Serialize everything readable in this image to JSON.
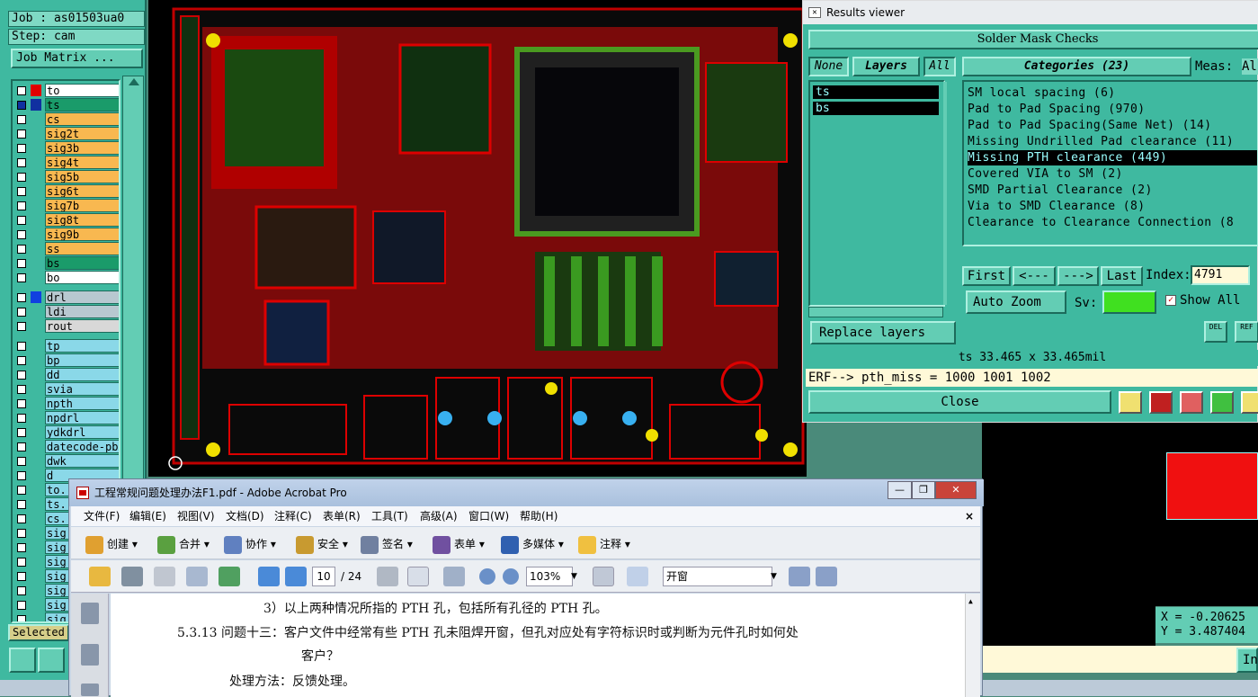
{
  "left_panel": {
    "job_label": "Job : as01503ua0",
    "step_label": "Step: cam",
    "job_matrix_button": "Job Matrix ...",
    "layers": [
      {
        "name": "to",
        "color": "#e00000",
        "bg": "#ffffff",
        "checked": false
      },
      {
        "name": "ts",
        "color": "#1030a0",
        "bg": "#1a9b6a",
        "checked": true
      },
      {
        "name": "cs",
        "color": "",
        "bg": "#f8b850",
        "checked": false
      },
      {
        "name": "sig2t",
        "color": "",
        "bg": "#f8b850",
        "checked": false
      },
      {
        "name": "sig3b",
        "color": "",
        "bg": "#f8b850",
        "checked": false
      },
      {
        "name": "sig4t",
        "color": "",
        "bg": "#f8b850",
        "checked": false
      },
      {
        "name": "sig5b",
        "color": "",
        "bg": "#f8b850",
        "checked": false
      },
      {
        "name": "sig6t",
        "color": "",
        "bg": "#f8b850",
        "checked": false
      },
      {
        "name": "sig7b",
        "color": "",
        "bg": "#f8b850",
        "checked": false
      },
      {
        "name": "sig8t",
        "color": "",
        "bg": "#f8b850",
        "checked": false
      },
      {
        "name": "sig9b",
        "color": "",
        "bg": "#f8b850",
        "checked": false
      },
      {
        "name": "ss",
        "color": "",
        "bg": "#f8b850",
        "checked": false
      },
      {
        "name": "bs",
        "color": "",
        "bg": "#1a9b6a",
        "checked": false
      },
      {
        "name": "bo",
        "color": "",
        "bg": "#ffffff",
        "checked": false
      },
      {
        "name": "drl",
        "color": "#1040e0",
        "bg": "#b8c8d0",
        "checked": false
      },
      {
        "name": "ldi",
        "color": "",
        "bg": "#b8c8d0",
        "checked": false
      },
      {
        "name": "rout",
        "color": "",
        "bg": "#d8d8d8",
        "checked": false
      },
      {
        "name": "tp",
        "color": "",
        "bg": "#8ad8e8",
        "checked": false
      },
      {
        "name": "bp",
        "color": "",
        "bg": "#8ad8e8",
        "checked": false
      },
      {
        "name": "dd",
        "color": "",
        "bg": "#8ad8e8",
        "checked": false
      },
      {
        "name": "svia",
        "color": "",
        "bg": "#8ad8e8",
        "checked": false
      },
      {
        "name": "npth",
        "color": "",
        "bg": "#8ad8e8",
        "checked": false
      },
      {
        "name": "npdrl",
        "color": "",
        "bg": "#8ad8e8",
        "checked": false
      },
      {
        "name": "ydkdrl",
        "color": "",
        "bg": "#8ad8e8",
        "checked": false
      },
      {
        "name": "datecode-pbe",
        "color": "",
        "bg": "#8ad8e8",
        "checked": false
      },
      {
        "name": "dwk",
        "color": "",
        "bg": "#8ad8e8",
        "checked": false
      },
      {
        "name": "d",
        "color": "",
        "bg": "#8ad8e8",
        "checked": false
      },
      {
        "name": "to.",
        "color": "",
        "bg": "#8ad8e8",
        "checked": false
      },
      {
        "name": "ts.",
        "color": "",
        "bg": "#8ad8e8",
        "checked": false
      },
      {
        "name": "cs.",
        "color": "",
        "bg": "#8ad8e8",
        "checked": false
      },
      {
        "name": "sig",
        "color": "",
        "bg": "#8ad8e8",
        "checked": false
      },
      {
        "name": "sig",
        "color": "",
        "bg": "#8ad8e8",
        "checked": false
      },
      {
        "name": "sig",
        "color": "",
        "bg": "#8ad8e8",
        "checked": false
      },
      {
        "name": "sig",
        "color": "",
        "bg": "#8ad8e8",
        "checked": false
      },
      {
        "name": "sig",
        "color": "",
        "bg": "#8ad8e8",
        "checked": false
      },
      {
        "name": "sig",
        "color": "",
        "bg": "#8ad8e8",
        "checked": false
      },
      {
        "name": "sig",
        "color": "",
        "bg": "#8ad8e8",
        "checked": false
      }
    ],
    "selected_label": "Selected"
  },
  "results_viewer": {
    "window_title": "Results viewer",
    "panel_title": "Solder Mask Checks",
    "none_btn": "None",
    "layers_btn": "Layers",
    "all_btn": "All",
    "categories_btn": "Categories (23)",
    "meas_label": "Meas:",
    "meas_value": "Al",
    "layer_items": [
      "ts",
      "bs"
    ],
    "categories": [
      "SM local spacing (6)",
      "Pad to Pad Spacing (970)",
      "Pad to Pad Spacing(Same Net) (14)",
      "Missing Undrilled Pad clearance (11)",
      "Missing PTH clearance (449)",
      "Covered VIA to SM (2)",
      "SMD Partial Clearance (2)",
      "Via to SMD Clearance (8)",
      "Clearance to Clearance Connection (8"
    ],
    "selected_category_index": 4,
    "first_btn": "First",
    "prev_btn": "<---",
    "next_btn": "--->",
    "last_btn": "Last",
    "index_label": "Index:",
    "index_value": "4791",
    "auto_zoom": "Auto Zoom",
    "sv_label": "Sv:",
    "show_all": "Show All",
    "replace_layers": "Replace layers",
    "del_label": "DEL",
    "ref_label": "REF",
    "status": "ts 33.465 x 33.465mil",
    "erf": "ERF--> pth_miss = 1000 1001 1002",
    "close": "Close"
  },
  "right_side": {
    "coord_x": "X = -0.20625",
    "coord_y": "Y = 3.487404",
    "in_btn": "In"
  },
  "acrobat": {
    "title": "工程常规问题处理办法F1.pdf - Adobe Acrobat Pro",
    "menus": [
      "文件(F)",
      "编辑(E)",
      "视图(V)",
      "文档(D)",
      "注释(C)",
      "表单(R)",
      "工具(T)",
      "高级(A)",
      "窗口(W)",
      "帮助(H)"
    ],
    "tools": [
      "创建",
      "合并",
      "协作",
      "安全",
      "签名",
      "表单",
      "多媒体",
      "注释"
    ],
    "page_current": "10",
    "page_total": "/ 24",
    "zoom": "103%",
    "find": "开窗",
    "doc_lines": [
      "3）以上两种情况所指的 PTH 孔，包括所有孔径的 PTH 孔。",
      "5.3.13 问题十三：客户文件中经常有些 PTH 孔未阻焊开窗，但孔对应处有字符标识时或判断为元件孔时如何处",
      "客户？",
      "处理方法：反馈处理。"
    ]
  }
}
